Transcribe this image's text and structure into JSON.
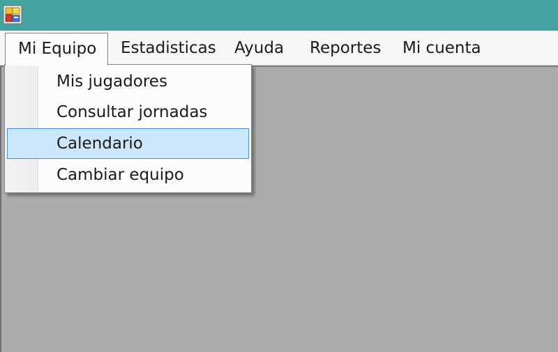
{
  "titlebar": {
    "icon": "windows-forms-app-icon",
    "background": "#43a3a0"
  },
  "menubar": {
    "items": [
      {
        "label": "Mi Equipo",
        "open": true
      },
      {
        "label": "Estadisticas"
      },
      {
        "label": "Ayuda"
      },
      {
        "label": "Reportes"
      },
      {
        "label": "Mi cuenta"
      }
    ]
  },
  "dropdown": {
    "items": [
      {
        "label": "Mis jugadores"
      },
      {
        "label": "Consultar jornadas"
      },
      {
        "label": "Calendario",
        "highlighted": true
      },
      {
        "label": "Cambiar equipo"
      }
    ],
    "highlight_color": "#cce6fb",
    "highlight_border": "#3e8fdc"
  },
  "workspace": {
    "background": "#ababab"
  }
}
